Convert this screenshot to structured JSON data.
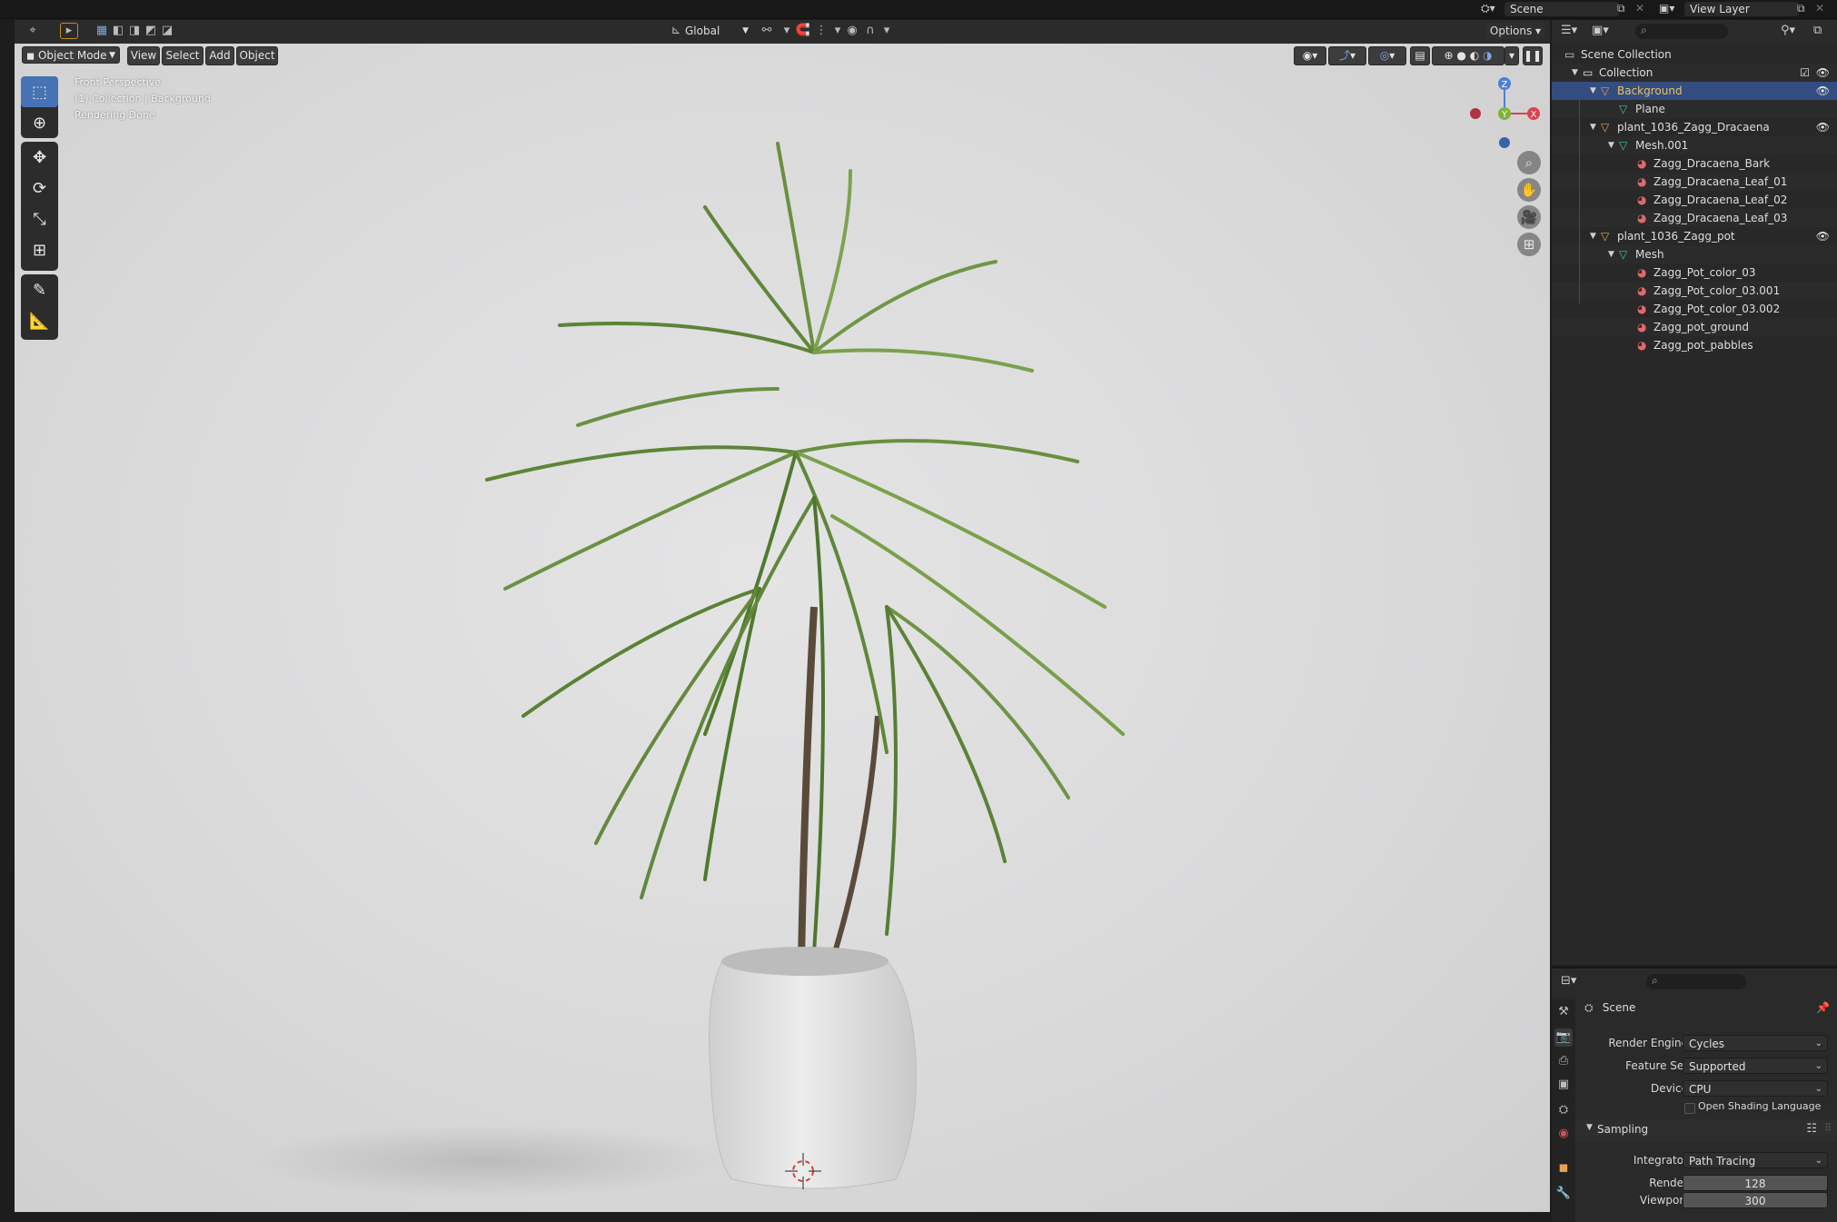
{
  "topbar": {
    "scene_label": "Scene",
    "view_layer_label": "View Layer"
  },
  "header": {
    "transform_orientation": "Global",
    "options_label": "Options"
  },
  "viewport": {
    "mode_label": "Object Mode",
    "menus": [
      "View",
      "Select",
      "Add",
      "Object"
    ],
    "overlay_lines": [
      "Front Perspective",
      "(1) Collection | Background",
      "Rendering Done"
    ],
    "gizmo": {
      "z": "Z",
      "y": "Y",
      "x": "X"
    }
  },
  "outliner": {
    "rows": [
      {
        "label": "Scene Collection",
        "indent": 0,
        "icon": "scene-collection-icon",
        "selected": false
      },
      {
        "label": "Collection",
        "indent": 1,
        "icon": "collection-icon",
        "selected": false
      },
      {
        "label": "Background",
        "indent": 2,
        "icon": "object-icon",
        "selected": true
      },
      {
        "label": "Plane",
        "indent": 3,
        "icon": "mesh-icon",
        "selected": false
      },
      {
        "label": "plant_1036_Zagg_Dracaena",
        "indent": 2,
        "icon": "object-icon",
        "selected": false
      },
      {
        "label": "Mesh.001",
        "indent": 3,
        "icon": "mesh-icon",
        "selected": false
      },
      {
        "label": "Zagg_Dracaena_Bark",
        "indent": 4,
        "icon": "material-icon",
        "selected": false
      },
      {
        "label": "Zagg_Dracaena_Leaf_01",
        "indent": 4,
        "icon": "material-icon",
        "selected": false
      },
      {
        "label": "Zagg_Dracaena_Leaf_02",
        "indent": 4,
        "icon": "material-icon",
        "selected": false
      },
      {
        "label": "Zagg_Dracaena_Leaf_03",
        "indent": 4,
        "icon": "material-icon",
        "selected": false
      },
      {
        "label": "plant_1036_Zagg_pot",
        "indent": 2,
        "icon": "object-icon",
        "selected": false
      },
      {
        "label": "Mesh",
        "indent": 3,
        "icon": "mesh-icon",
        "selected": false
      },
      {
        "label": "Zagg_Pot_color_03",
        "indent": 4,
        "icon": "material-icon",
        "selected": false
      },
      {
        "label": "Zagg_Pot_color_03.001",
        "indent": 4,
        "icon": "material-icon",
        "selected": false
      },
      {
        "label": "Zagg_Pot_color_03.002",
        "indent": 4,
        "icon": "material-icon",
        "selected": false
      },
      {
        "label": "Zagg_pot_ground",
        "indent": 4,
        "icon": "material-icon",
        "selected": false
      },
      {
        "label": "Zagg_pot_pabbles",
        "indent": 4,
        "icon": "material-icon",
        "selected": false
      }
    ]
  },
  "properties": {
    "context_label": "Scene",
    "render_engine_label": "Render Engine",
    "render_engine_value": "Cycles",
    "feature_set_label": "Feature Set",
    "feature_set_value": "Supported",
    "device_label": "Device",
    "device_value": "CPU",
    "osl_label": "Open Shading Language",
    "sampling_label": "Sampling",
    "integrator_label": "Integrator",
    "integrator_value": "Path Tracing",
    "render_label": "Render",
    "render_value": "128",
    "viewport_label": "Viewport",
    "viewport_value": "300"
  },
  "colors": {
    "selection": "#334d80",
    "active_tool": "#4772b3",
    "object_icon": "#e9a14e",
    "mesh_icon": "#3fc7a4",
    "material_icon": "#e06a6a"
  }
}
